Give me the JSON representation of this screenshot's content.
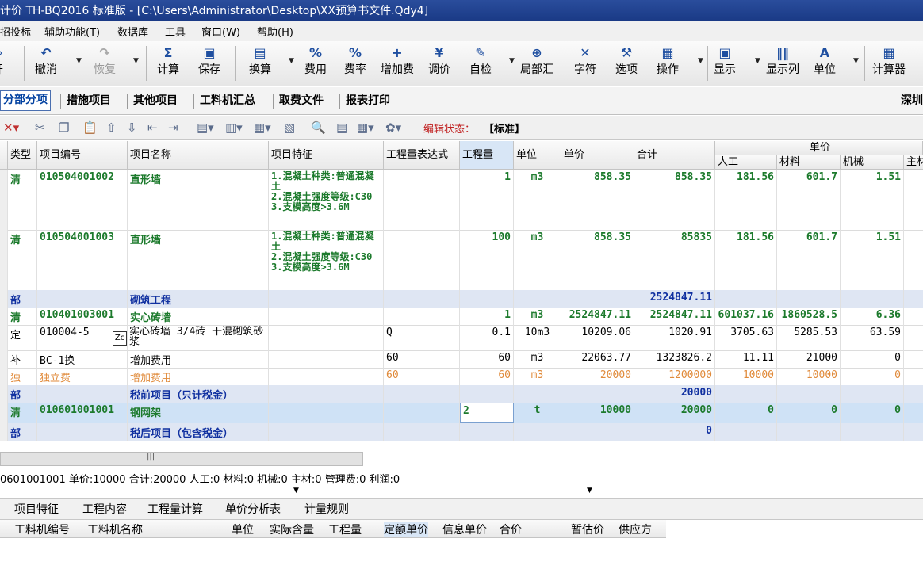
{
  "window": {
    "title": "计价 TH-BQ2016 标准版 - [C:\\Users\\Administrator\\Desktop\\XX预算书文件.Qdy4]"
  },
  "menu": [
    "招投标",
    "辅助功能(T)",
    "数据库",
    "工具",
    "窗口(W)",
    "帮助(H)"
  ],
  "toolbar": [
    {
      "label": "开",
      "icon": "open-icon",
      "glyph": "⇨"
    },
    {
      "label": "撤消",
      "icon": "undo-icon",
      "glyph": "↶"
    },
    {
      "label": "恢复",
      "icon": "redo-icon",
      "glyph": "↷"
    },
    {
      "label": "计算",
      "icon": "calculate-icon",
      "glyph": "Σ"
    },
    {
      "label": "保存",
      "icon": "save-icon",
      "glyph": "▣"
    },
    {
      "label": "换算",
      "icon": "convert-icon",
      "glyph": "▤"
    },
    {
      "label": "费用",
      "icon": "fee-icon",
      "glyph": "%"
    },
    {
      "label": "费率",
      "icon": "rate-icon",
      "glyph": "%"
    },
    {
      "label": "增加费",
      "icon": "add-fee-icon",
      "glyph": "+"
    },
    {
      "label": "调价",
      "icon": "adjust-price-icon",
      "glyph": "¥"
    },
    {
      "label": "自检",
      "icon": "self-check-icon",
      "glyph": "✎"
    },
    {
      "label": "局部汇",
      "icon": "partial-summary-icon",
      "glyph": "⊕"
    },
    {
      "label": "字符",
      "icon": "character-icon",
      "glyph": "✕"
    },
    {
      "label": "选项",
      "icon": "options-icon",
      "glyph": "⚒"
    },
    {
      "label": "操作",
      "icon": "operation-icon",
      "glyph": "▦"
    },
    {
      "label": "显示",
      "icon": "display-icon",
      "glyph": "▣"
    },
    {
      "label": "显示列",
      "icon": "display-columns-icon",
      "glyph": "‖‖"
    },
    {
      "label": "单位",
      "icon": "unit-icon",
      "glyph": "A"
    },
    {
      "label": "计算器",
      "icon": "calculator-icon",
      "glyph": "▦"
    }
  ],
  "tabs": [
    "分部分项",
    "措施项目",
    "其他项目",
    "工料机汇总",
    "取费文件",
    "报表打印"
  ],
  "tab_right": "深圳",
  "edit_toolbar": {
    "status_label": "编辑状态：",
    "status_value": "【标准】"
  },
  "grid": {
    "headers": [
      "类型",
      "项目编号",
      "项目名称",
      "项目特征",
      "工程量表达式",
      "工程量",
      "单位",
      "单价",
      "合计"
    ],
    "unit_price_group": "单价",
    "sub_headers": [
      "人工",
      "材料",
      "机械",
      "主材"
    ],
    "rows": [
      {
        "type": "清",
        "code": "010504001002",
        "name": "直形墙",
        "feature": "1.混凝土种类:普通混凝土\n2.混凝土强度等级:C30\n3.支模高度>3.6M",
        "expr": "",
        "qty": "1",
        "unit": "m3",
        "price": "858.35",
        "total": "858.35",
        "labor": "181.56",
        "material": "601.7",
        "machine": "1.51",
        "style": "green"
      },
      {
        "type": "清",
        "code": "010504001003",
        "name": "直形墙",
        "feature": "1.混凝土种类:普通混凝土\n2.混凝土强度等级:C30\n3.支模高度>3.6M",
        "expr": "",
        "qty": "100",
        "unit": "m3",
        "price": "858.35",
        "total": "85835",
        "labor": "181.56",
        "material": "601.7",
        "machine": "1.51",
        "style": "green"
      },
      {
        "type": "部",
        "code": "",
        "name": "砌筑工程",
        "feature": "",
        "expr": "",
        "qty": "",
        "unit": "",
        "price": "",
        "total": "2524847.11",
        "labor": "",
        "material": "",
        "machine": "",
        "style": "blue"
      },
      {
        "type": "清",
        "code": "010401003001",
        "name": "实心砖墙",
        "feature": "",
        "expr": "",
        "qty": "1",
        "unit": "m3",
        "price": "2524847.11",
        "total": "2524847.11",
        "labor": "601037.16",
        "material": "1860528.5",
        "machine": "6.36",
        "style": "green"
      },
      {
        "type": "定",
        "code": "010004-5",
        "name": "实心砖墙 3/4砖 干混砌筑砂浆",
        "feature": "",
        "expr": "Q",
        "qty": "0.1",
        "unit": "10m3",
        "price": "10209.06",
        "total": "1020.91",
        "labor": "3705.63",
        "material": "5285.53",
        "machine": "63.59",
        "style": "plain"
      },
      {
        "type": "补",
        "code": "BC-1换",
        "name": "增加费用",
        "feature": "",
        "expr": "60",
        "qty": "60",
        "unit": "m3",
        "price": "22063.77",
        "total": "1323826.2",
        "labor": "11.11",
        "material": "21000",
        "machine": "0",
        "style": "plain"
      },
      {
        "type": "独",
        "code": "独立费",
        "name": "增加费用",
        "feature": "",
        "expr": "60",
        "qty": "60",
        "unit": "m3",
        "price": "20000",
        "total": "1200000",
        "labor": "10000",
        "material": "10000",
        "machine": "0",
        "style": "orange"
      },
      {
        "type": "部",
        "code": "",
        "name": "税前项目（只计税金）",
        "feature": "",
        "expr": "",
        "qty": "",
        "unit": "",
        "price": "",
        "total": "20000",
        "labor": "",
        "material": "",
        "machine": "",
        "style": "blue"
      },
      {
        "type": "清",
        "code": "010601001001",
        "name": "钢网架",
        "feature": "",
        "expr": "",
        "qty": "2",
        "unit": "t",
        "price": "10000",
        "total": "20000",
        "labor": "0",
        "material": "0",
        "machine": "0",
        "style": "selected"
      },
      {
        "type": "部",
        "code": "",
        "name": "税后项目（包含税金）",
        "feature": "",
        "expr": "",
        "qty": "",
        "unit": "",
        "price": "",
        "total": "0",
        "labor": "",
        "material": "",
        "machine": "",
        "style": "blue"
      }
    ]
  },
  "status_line": "0601001001  单价:10000  合计:20000  人工:0  材料:0  机械:0  主材:0  管理费:0  利润:0",
  "bottom_tabs": [
    "项目特征",
    "工程内容",
    "工程量计算",
    "单价分析表",
    "计量规则"
  ],
  "sub_headers": [
    "工料机编号",
    "工料机名称",
    "单位",
    "实际含量",
    "工程量",
    "定额单价",
    "信息单价",
    "合价",
    "暂估价",
    "供应方"
  ],
  "colors": {
    "title_bar": "#1a3a86",
    "green_text": "#1c7a2c",
    "blue_text": "#1030a0",
    "orange_text": "#e08a3a",
    "selected_row": "#cfe2f6"
  }
}
